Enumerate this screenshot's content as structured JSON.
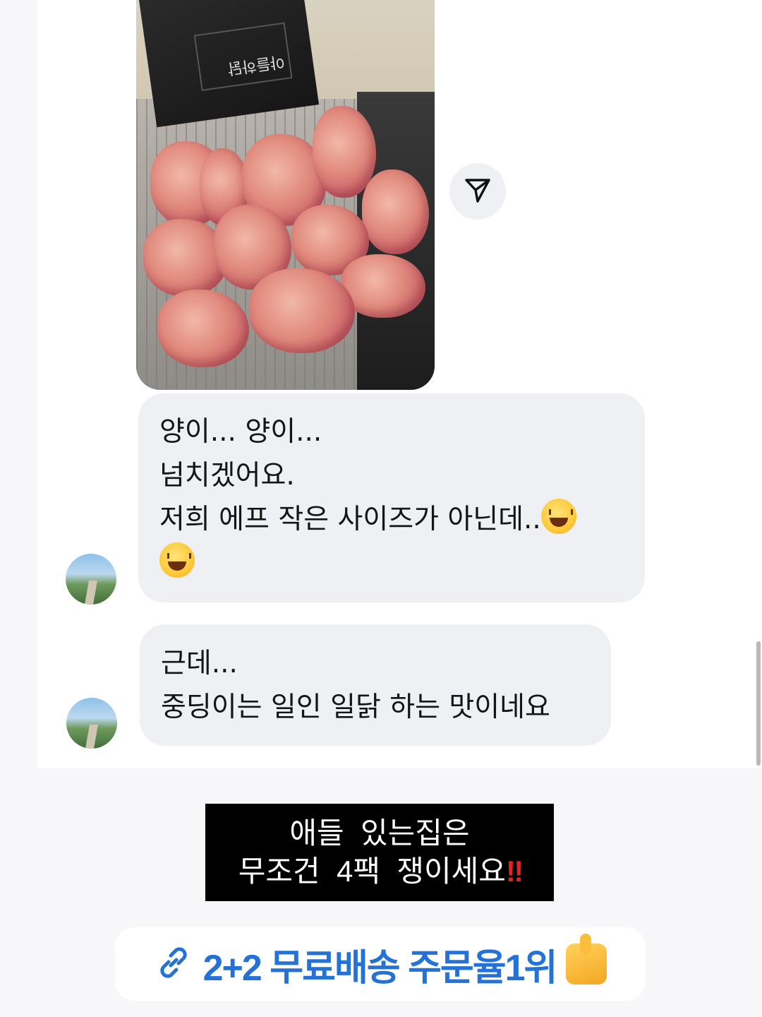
{
  "photo": {
    "package_label": "야들하닭"
  },
  "messages": [
    {
      "lines": [
        "양이... 양이...",
        "넘치겠어요.",
        "저희 에프 작은 사이즈가 아닌데.."
      ],
      "emoji": "grinning-squinting-face"
    },
    {
      "lines": [
        "근데...",
        "중딩이는 일인 일닭 하는 맛이네요"
      ]
    }
  ],
  "caption": {
    "line1": "애들  있는집은",
    "line2": "무조건  4팩  쟁이세요",
    "alert_mark": "‼"
  },
  "link": {
    "text": "2+2 무료배송 주문율1위",
    "icon": "link-icon",
    "emoji": "thumbs-up"
  },
  "colors": {
    "link": "#2472d8",
    "bubble": "#eff0f4",
    "caption_bg": "#000000",
    "alert": "#e32222"
  }
}
